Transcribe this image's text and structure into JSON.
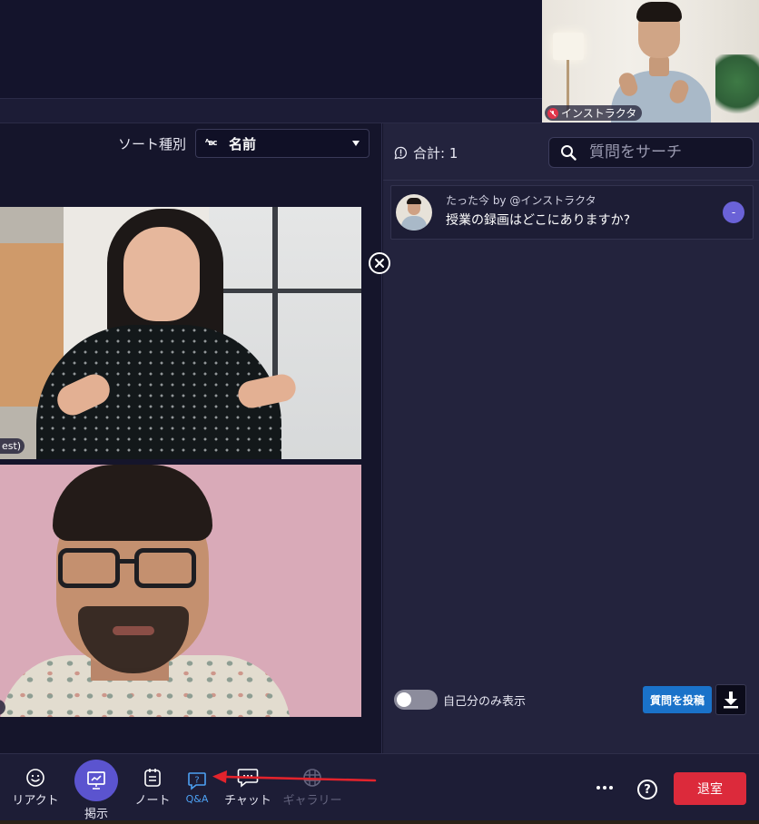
{
  "self_view": {
    "name": "インストラクタ"
  },
  "sort": {
    "label": "ソート種別",
    "value": "名前",
    "abc_icon_text": "ᴬʙc"
  },
  "tiles": {
    "woman_badge": "est)"
  },
  "qa": {
    "total_label": "合計: 1",
    "search_placeholder": "質問をサーチ",
    "questions": [
      {
        "meta": "たった今 by @インストラクタ",
        "text": "授業の録画はどこにありますか?",
        "action": "-"
      }
    ],
    "toggle_label": "自己分のみ表示",
    "post_button": "質問を投稿"
  },
  "toolbar": {
    "reaction": "リアクト",
    "present": "掲示",
    "notes": "ノート",
    "qa": "Q&A",
    "chat": "チャット",
    "gallery": "ギャラリー",
    "help": "?",
    "leave": "退室"
  },
  "colors": {
    "accent_purple": "#5b54cf",
    "qa_active_blue": "#4da1f3",
    "post_button_blue": "#1a72c9",
    "leave_red": "#dc2a3b",
    "annotation_red": "#e3232c"
  }
}
